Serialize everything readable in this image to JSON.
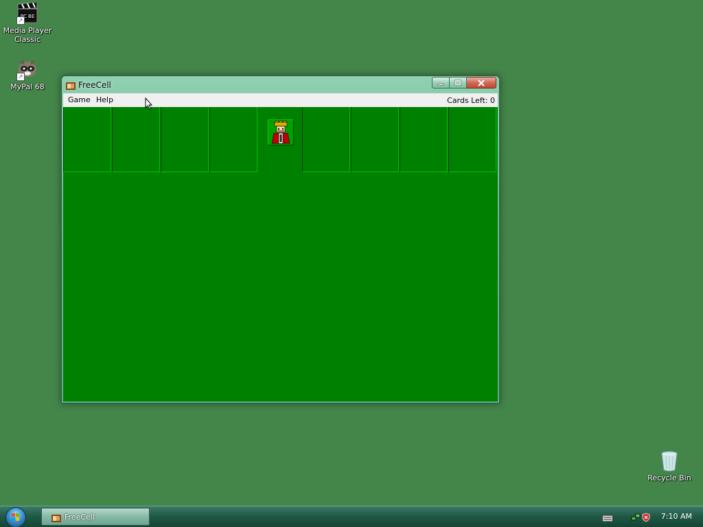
{
  "desktop": {
    "icons": [
      {
        "label": "Media Player Classic",
        "icon": "media-player-icon"
      },
      {
        "label": "MyPal 68",
        "icon": "mypal-icon"
      },
      {
        "label": "Recycle Bin",
        "icon": "recycle-bin-icon"
      }
    ]
  },
  "window": {
    "title": "FreeCell",
    "menu": [
      {
        "label": "Game"
      },
      {
        "label": "Help"
      }
    ],
    "cards_left": "Cards Left: 0",
    "felt_color": "#008000"
  },
  "taskbar": {
    "buttons": [
      {
        "label": "FreeCell"
      }
    ],
    "clock": "7:10 AM"
  }
}
